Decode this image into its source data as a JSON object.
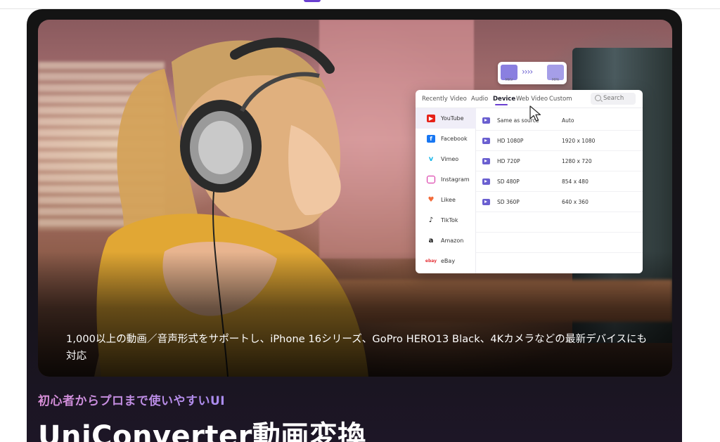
{
  "hero": {
    "caption": "1,000以上の動画／音声形式をサポートし、iPhone 16シリーズ、GoPro HERO13 Black、4Kカメラなどの最新デバイスにも対応"
  },
  "format_badge": {
    "from": "MKV",
    "to": "MPA",
    "arrows": "››››"
  },
  "converter": {
    "tabs": [
      "Recently",
      "Video",
      "Audio",
      "Device",
      "Web Video",
      "Custom"
    ],
    "active_tab": "Device",
    "search_placeholder": "Search",
    "platforms": [
      {
        "label": "YouTube",
        "icon": "youtube-icon",
        "color": "#e62117"
      },
      {
        "label": "Facebook",
        "icon": "facebook-icon",
        "color": "#1877f2"
      },
      {
        "label": "Vimeo",
        "icon": "vimeo-icon",
        "color": "#1ab7ea"
      },
      {
        "label": "Instagram",
        "icon": "instagram-icon",
        "color": "#d6249f"
      },
      {
        "label": "Likee",
        "icon": "likee-icon",
        "color": "#f26b3a"
      },
      {
        "label": "TikTok",
        "icon": "tiktok-icon",
        "color": "#111111"
      },
      {
        "label": "Amazon",
        "icon": "amazon-icon",
        "color": "#111111"
      },
      {
        "label": "eBay",
        "icon": "ebay-icon",
        "color": "#e53238"
      }
    ],
    "active_platform": "YouTube",
    "presets": [
      {
        "quality": "Same as source",
        "resolution": "Auto"
      },
      {
        "quality": "HD 1080P",
        "resolution": "1920 x 1080"
      },
      {
        "quality": "HD 720P",
        "resolution": "1280 x 720"
      },
      {
        "quality": "SD 480P",
        "resolution": "854 x 480"
      },
      {
        "quality": "SD 360P",
        "resolution": "640 x 360"
      }
    ]
  },
  "section": {
    "subtitle": "初心者からプロまで使いやすいUI",
    "title": "UniConverter動画変換"
  },
  "colors": {
    "accent": "#6a3fd0",
    "subtitle_gradient_start": "#d98fd8",
    "subtitle_gradient_end": "#a98cf0"
  }
}
